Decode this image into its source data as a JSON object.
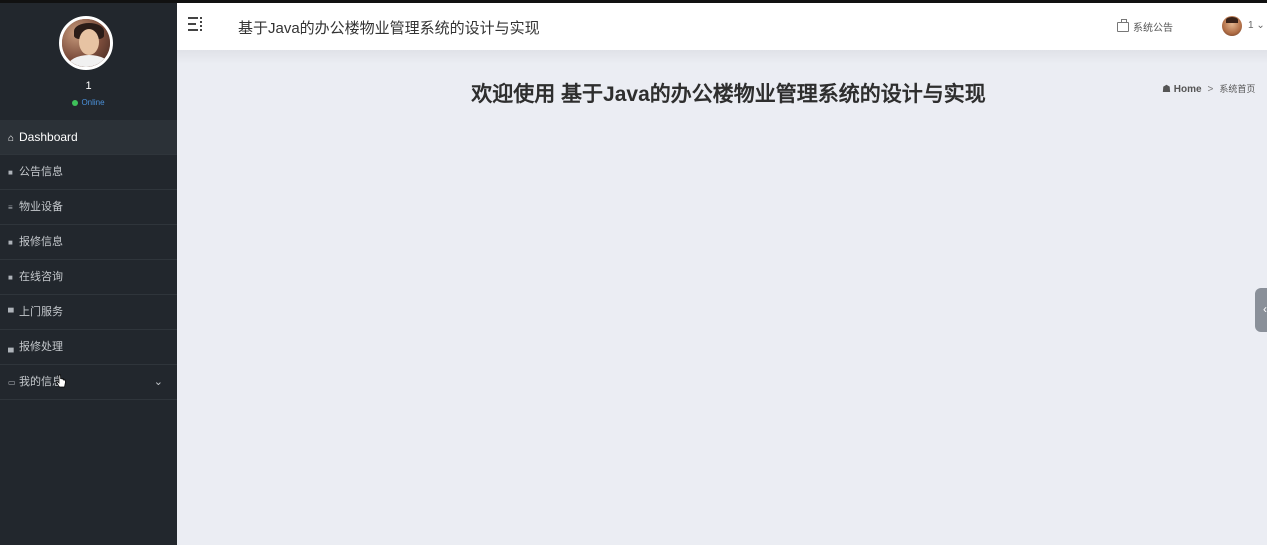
{
  "sidebar": {
    "user_name": "1",
    "status": "Online",
    "items": [
      {
        "label": "Dashboard",
        "icon": "home-icon"
      },
      {
        "label": "公告信息",
        "icon": "grid-icon"
      },
      {
        "label": "物业设备",
        "icon": "list-icon"
      },
      {
        "label": "报修信息",
        "icon": "grid-icon"
      },
      {
        "label": "在线咨询",
        "icon": "grid-icon"
      },
      {
        "label": "上门服务",
        "icon": "monitor-icon"
      },
      {
        "label": "报修处理",
        "icon": "briefcase-icon"
      },
      {
        "label": "我的信息",
        "icon": "card-icon"
      }
    ]
  },
  "header": {
    "title": "基于Java的办公楼物业管理系统的设计与实现",
    "notice_label": "系统公告",
    "user_label": "1"
  },
  "main": {
    "welcome": "欢迎使用 基于Java的办公楼物业管理系统的设计与实现",
    "breadcrumb": {
      "home": "Home",
      "separator": ">",
      "current": "系统首页"
    }
  },
  "colors": {
    "sidebar_bg": "#22272d",
    "content_bg": "#ebedf3",
    "status_dot": "#3ec15a",
    "status_text": "#4a90d9"
  }
}
